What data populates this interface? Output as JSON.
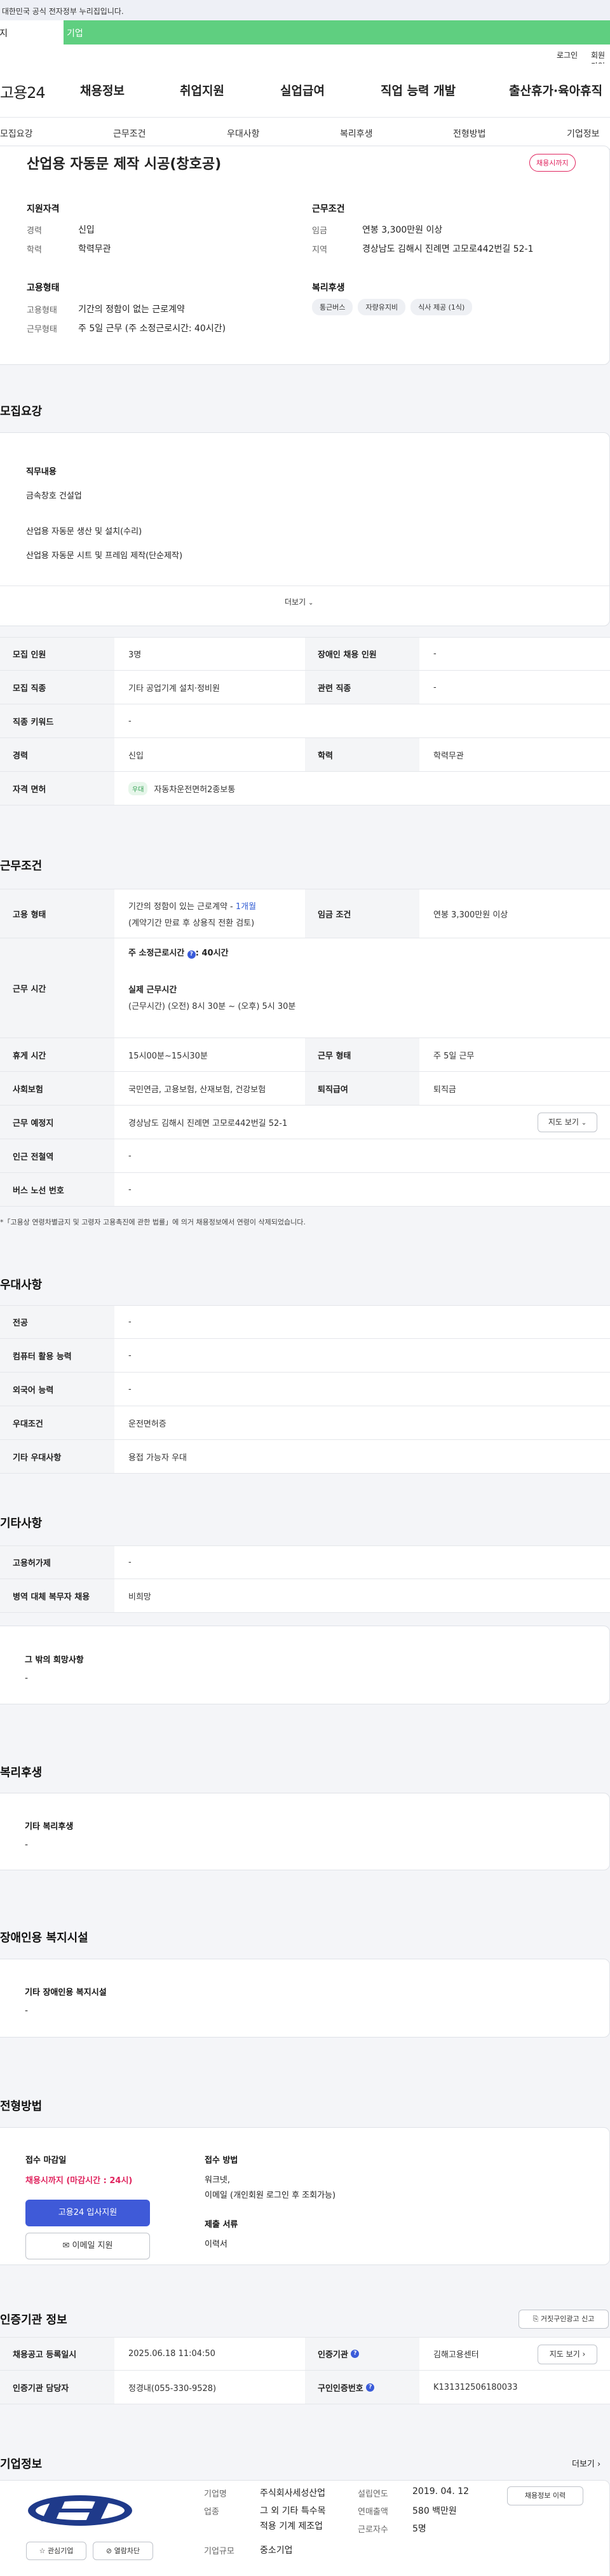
{
  "gov_bar": "이 누리집은 대한민국 공식 전자정부 누리집입니다.",
  "notice": {
    "left": "긴급 공지",
    "right": "기업"
  },
  "util": {
    "login": "로그인",
    "signup": "회원가입"
  },
  "logo": "고용24",
  "gnb": [
    "채용정보",
    "취업지원",
    "실업급여",
    "직업 능력 개발",
    "출산휴가·육아휴직"
  ],
  "subtabs": [
    "모집요강",
    "근무조건",
    "우대사항",
    "복리후생",
    "전형방법",
    "기업정보"
  ],
  "summary": {
    "title": "산업용 자동문 제작 시공(창호공)",
    "badge": "채용시까지",
    "qual_title": "지원자격",
    "career_label": "경력",
    "career": "신입",
    "edu_label": "학력",
    "edu": "학력무관",
    "cond_title": "근무조건",
    "wage_label": "임금",
    "wage": "연봉 3,300만원 이상",
    "region_label": "지역",
    "region": "경상남도 김해시 진례면 고모로442번길 52-1",
    "emp_title": "고용형태",
    "emptype_label": "고용형태",
    "emptype": "기간의 정함이 없는 근로계약",
    "worktype_label": "근무형태",
    "worktype": "주 5일 근무 (주 소정근로시간: 40시간)",
    "welfare_title": "복리후생",
    "tags": [
      "통근버스",
      "자량유지비",
      "식사 제공 (1식)"
    ]
  },
  "recruit": {
    "title": "모집요강",
    "duty_title": "직무내용",
    "lines": [
      "금속창호 건설업",
      "산업용 자동문 생산 및 설치(수리)",
      "산업용 자동문 시트 및 프레임 제작(단순제작)"
    ],
    "more": "더보기",
    "headcount_label": "모집 인원",
    "headcount": "3명",
    "disabled_label": "장애인 채용 인원",
    "disabled": "-",
    "job_label": "모집 직종",
    "job": "기타 공업기계 설치·정비원",
    "related_label": "관련 직종",
    "related": "-",
    "keyword_label": "직종 키워드",
    "keyword": "-",
    "career_label": "경력",
    "career": "신입",
    "edu_label": "학력",
    "edu": "학력무관",
    "license_label": "자격 면허",
    "license_tag": "우대",
    "license": "자동차운전면허2종보통"
  },
  "work": {
    "title": "근무조건",
    "emptype_label": "고용 형태",
    "emptype_1": "기간의 정함이 있는 근로계약 - ",
    "emptype_period": "1개월",
    "emptype_2": "(계약기간 만료 후 상용직 전환 검토)",
    "wage_label": "임금 조건",
    "wage": "연봉 3,300만원 이상",
    "hours_label": "근무 시간",
    "hours_std": "주 소정근로시간",
    "hours_std_val": ": 40시간",
    "hours_actual": "실제 근무시간",
    "hours_detail": "(근무시간) (오전) 8시 30분 ~ (오후) 5시 30분",
    "break_label": "휴게 시간",
    "break": "15시00분~15시30분",
    "form_label": "근무 형태",
    "form": "주 5일 근무",
    "insurance_label": "사회보험",
    "insurance": "국민연금, 고용보험, 산재보험, 건강보험",
    "severance_label": "퇴직급여",
    "severance": "퇴직금",
    "place_label": "근무 예정지",
    "place": "경상남도 김해시 진례면 고모로442번길 52-1",
    "map_btn": "지도 보기",
    "subway_label": "인근 전철역",
    "subway": "-",
    "bus_label": "버스 노선 번호",
    "bus": "-",
    "note": "*「고용상 연령차별금지 및 고령자 고용촉진에 관한 법률」에 의거 채용정보에서 연령이 삭제되었습니다."
  },
  "pref": {
    "title": "우대사항",
    "major_label": "전공",
    "major": "-",
    "pc_label": "컴퓨터 활용 능력",
    "pc": "-",
    "lang_label": "외국어 능력",
    "lang": "-",
    "cond_label": "우대조건",
    "cond": "운전면허증",
    "etc_label": "기타 우대사항",
    "etc": "용접 가능자 우대"
  },
  "etc": {
    "title": "기타사항",
    "insurance_label": "고용허가제",
    "insurance": "-",
    "military_label": "병역 대체 복무자 채용",
    "military": "비희망",
    "other_title": "그 밖의 희망사항",
    "other": "-"
  },
  "welfare": {
    "title": "복리후생",
    "sub": "기타 복리후생",
    "val": "-"
  },
  "disabled": {
    "title": "장애인용 복지시설",
    "sub": "기타 장애인용 복지시설",
    "val": "-"
  },
  "process": {
    "title": "전형방법",
    "deadline_label": "접수 마감일",
    "deadline": "채용시까지 (마감시간 : 24시)",
    "apply_btn": "고용24 입사지원",
    "email_btn": "이메일 지원",
    "method_label": "접수 방법",
    "method_1": "워크넷,",
    "method_2": "이메일 (개인회원 로그인 후 조회가능)",
    "docs_label": "제출 서류",
    "docs": "이력서"
  },
  "agency": {
    "title": "인증기관 정보",
    "report_btn": "거짓구인광고 신고",
    "date_label": "채용공고 등록일시",
    "date": "2025.06.18 11:04:50",
    "org_label": "인증기관",
    "org": "김해고용센터",
    "map_btn": "지도 보기",
    "manager_label": "인증기관 담당자",
    "manager": "정경내(055-330-9528)",
    "reqno_label": "구인인증번호",
    "reqno": "K131312506180033"
  },
  "company": {
    "title": "기업정보",
    "more": "더보기",
    "fav_btn": "관심기업",
    "block_btn": "열람차단",
    "name_label": "기업명",
    "name": "주식회사세성산업",
    "industry_label": "업종",
    "industry_1": "그 외 기타 특수목",
    "industry_2": "적용 기계 제조업",
    "size_label": "기업규모",
    "size": "중소기업",
    "founded_label": "설립연도",
    "founded": "2019. 04. 12",
    "sales_label": "연매출액",
    "sales": "580 백만원",
    "employees_label": "근로자수",
    "employees": "5명",
    "jobs_btn": "채용정보 이력"
  }
}
